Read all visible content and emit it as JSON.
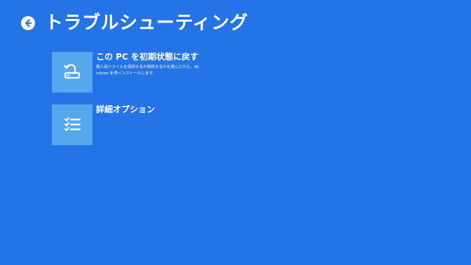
{
  "header": {
    "title": "トラブルシューティング",
    "back_icon": "back-arrow-icon"
  },
  "colors": {
    "background": "#2474e8",
    "tile": "#55a8ee",
    "text": "#ffffff"
  },
  "options": [
    {
      "title": "この PC を初期状態に戻す",
      "description": "個人用ファイルを保持するか削除するかを選んだから、Windows を再インストールします。",
      "icon": "reset-pc-icon"
    },
    {
      "title": "詳細オプション",
      "description": "",
      "icon": "checklist-icon"
    }
  ]
}
